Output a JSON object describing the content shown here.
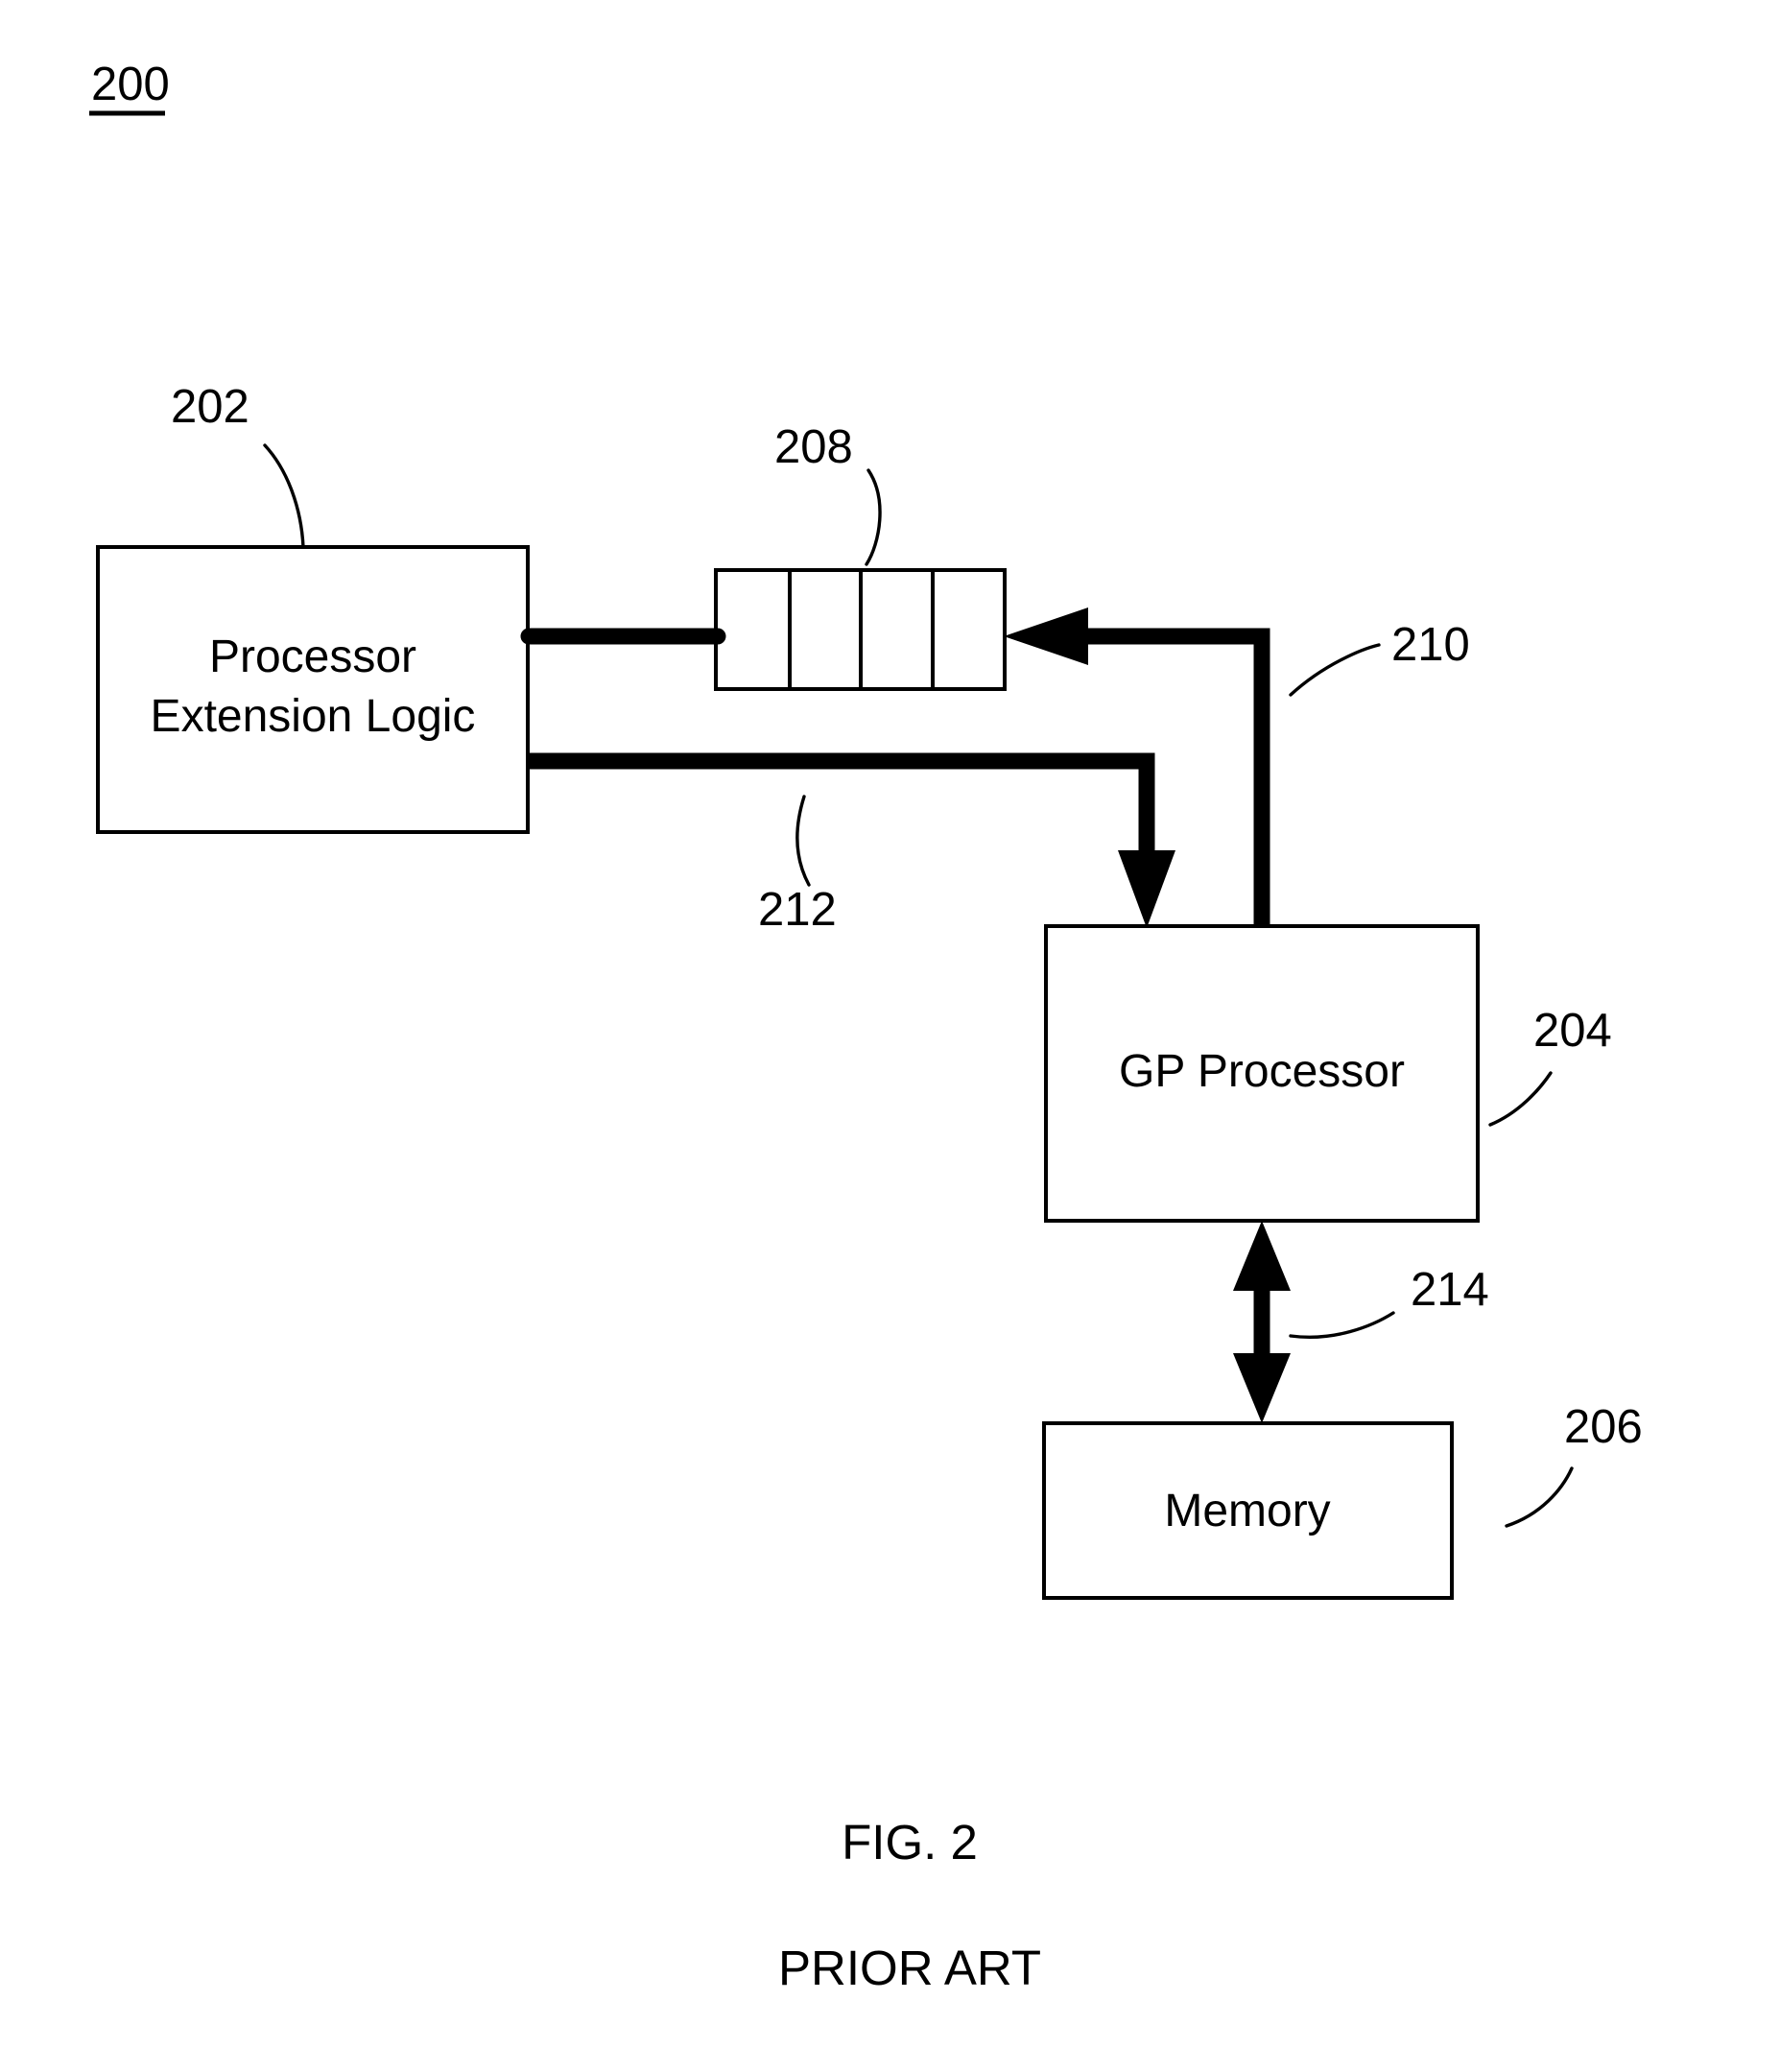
{
  "figure": {
    "figure_number_label": "200",
    "caption_primary": "FIG. 2",
    "caption_secondary": "PRIOR ART",
    "stroke_color": "#000000",
    "background_color": "#ffffff"
  },
  "blocks": [
    {
      "ref": "202",
      "label_line1": "Processor",
      "label_line2": "Extension Logic",
      "name": "processor-extension-logic"
    },
    {
      "ref": "208",
      "label": "",
      "cells": 4,
      "name": "fifo-queue"
    },
    {
      "ref": "204",
      "label": "GP Processor",
      "name": "gp-processor"
    },
    {
      "ref": "206",
      "label": "Memory",
      "name": "memory"
    }
  ],
  "connections": [
    {
      "ref": "210",
      "name": "gp-processor-to-fifo",
      "from": "gp-processor",
      "to": "fifo-queue",
      "arrowheads": "single",
      "style": "thick"
    },
    {
      "ref": "212",
      "name": "processor-extension-logic-to-gp-processor",
      "from": "processor-extension-logic",
      "to": "gp-processor",
      "arrowheads": "single",
      "style": "thick"
    },
    {
      "ref": "214",
      "name": "gp-processor-to-memory",
      "from": "gp-processor",
      "to": "memory",
      "arrowheads": "double",
      "style": "thick"
    },
    {
      "ref": "",
      "name": "fifo-to-processor-extension-logic",
      "from": "fifo-queue",
      "to": "processor-extension-logic",
      "arrowheads": "none",
      "style": "thick"
    }
  ]
}
